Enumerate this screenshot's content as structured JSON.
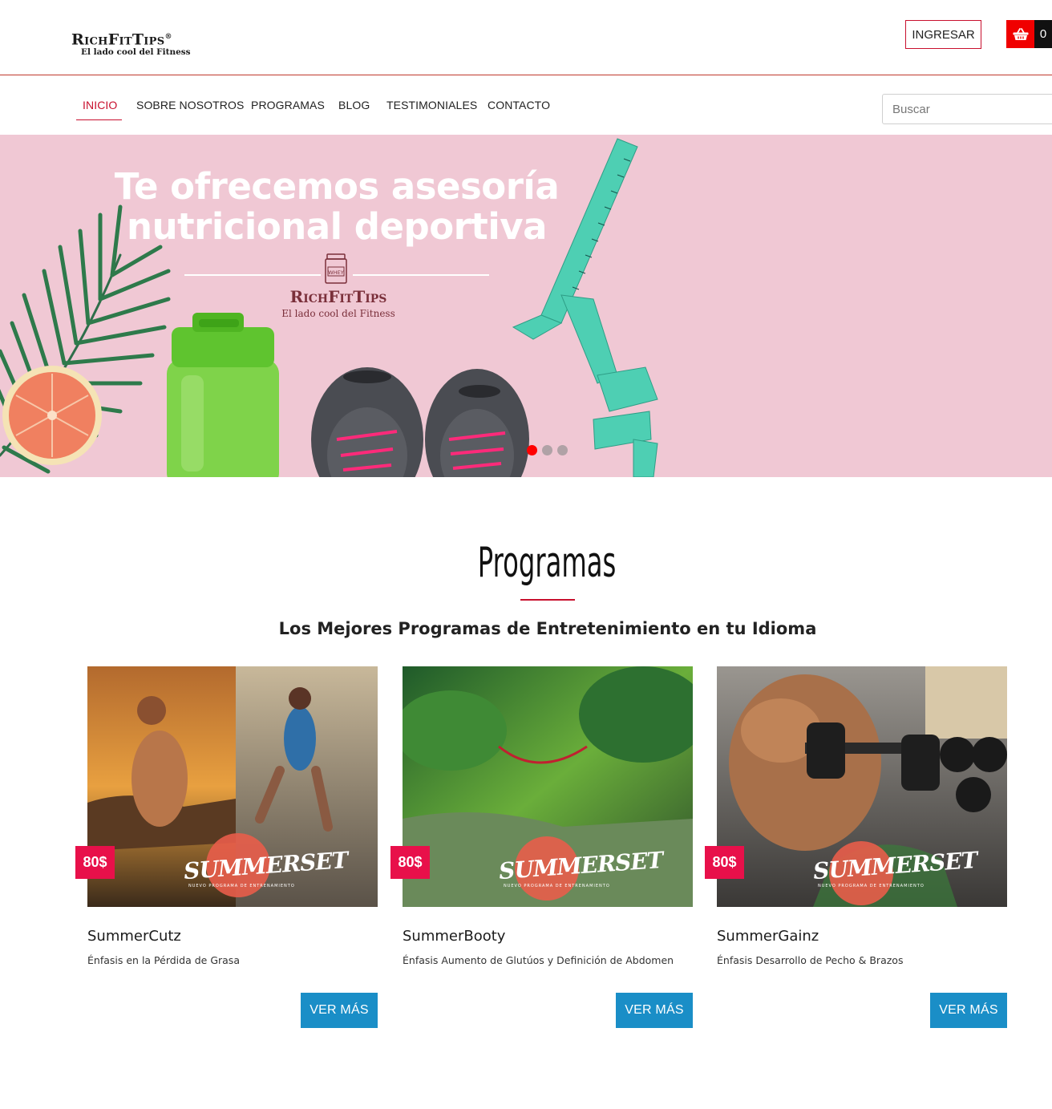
{
  "header": {
    "logo_main": "RichFitTips",
    "logo_reg": "®",
    "logo_tagline": "El lado cool del Fitness",
    "login_label": "INGRESAR",
    "cart_count": "0"
  },
  "nav": {
    "items": [
      {
        "label": "INICIO",
        "active": true
      },
      {
        "label": "SOBRE NOSOTROS",
        "active": false
      },
      {
        "label": "PROGRAMAS",
        "active": false
      },
      {
        "label": "BLOG",
        "active": false
      },
      {
        "label": "TESTIMONIALES",
        "active": false
      },
      {
        "label": "CONTACTO",
        "active": false
      }
    ],
    "search_placeholder": "Buscar"
  },
  "hero": {
    "headline_line1": "Te ofrecemos asesoría",
    "headline_line2": "nutricional deportiva",
    "jar_label": "WHEY",
    "brand": "RichFitTips",
    "brand_tagline": "El lado cool del Fitness",
    "slides": 3,
    "active_slide": 1
  },
  "programs": {
    "title": "Programas",
    "subtitle": "Los Mejores Programas de Entretenimiento en tu Idioma",
    "cards": [
      {
        "price": "80$",
        "name": "SummerCutz",
        "description": "Énfasis en la Pérdida de Grasa",
        "button": "VER MÁS",
        "badge": "SUMMERSET",
        "badge_sub": "NUEVO PROGRAMA DE ENTRENAMIENTO"
      },
      {
        "price": "80$",
        "name": "SummerBooty",
        "description": "Énfasis Aumento de Glutúos y Definición de Abdomen",
        "button": "VER MÁS",
        "badge": "SUMMERSET",
        "badge_sub": "NUEVO PROGRAMA DE ENTRENAMIENTO"
      },
      {
        "price": "80$",
        "name": "SummerGainz",
        "description": "Énfasis Desarrollo de Pecho & Brazos",
        "button": "VER MÁS",
        "badge": "SUMMERSET",
        "badge_sub": "NUEVO PROGRAMA DE ENTRENAMIENTO"
      }
    ]
  },
  "colors": {
    "accent_red": "#c8102e",
    "price_pink": "#e8104a",
    "button_blue": "#1a8ec7",
    "hero_pink": "#f0c8d4",
    "cart_red": "#f00000"
  },
  "icons": {
    "cart": "basket-icon",
    "jar": "whey-jar-icon"
  }
}
